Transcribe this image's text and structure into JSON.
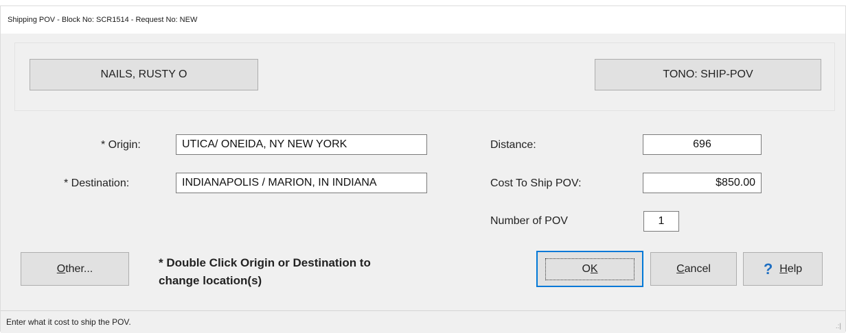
{
  "window": {
    "title": "Shipping POV - Block No: SCR1514 - Request No: NEW"
  },
  "header": {
    "member_button": "NAILS, RUSTY O",
    "tono_button": "TONO: SHIP-POV"
  },
  "form": {
    "origin_label": "* Origin:",
    "origin_value": "UTICA/ ONEIDA, NY NEW YORK",
    "destination_label": "* Destination:",
    "destination_value": "INDIANAPOLIS / MARION, IN INDIANA",
    "distance_label": "Distance:",
    "distance_value": "696",
    "cost_label": "Cost To Ship POV:",
    "cost_value": "$850.00",
    "num_pov_label": "Number of POV",
    "num_pov_value": "1"
  },
  "note": {
    "line1": "* Double Click Origin or Destination to",
    "line2": "change location(s)"
  },
  "buttons": {
    "other_accel": "O",
    "other_rest": "ther...",
    "ok_first": "O",
    "ok_accel": "K",
    "cancel_accel": "C",
    "cancel_rest": "ancel",
    "help_icon": "?",
    "help_accel": "H",
    "help_rest": "elp"
  },
  "status": {
    "text": "Enter what it cost to ship the POV.",
    "grip": ".:|"
  }
}
